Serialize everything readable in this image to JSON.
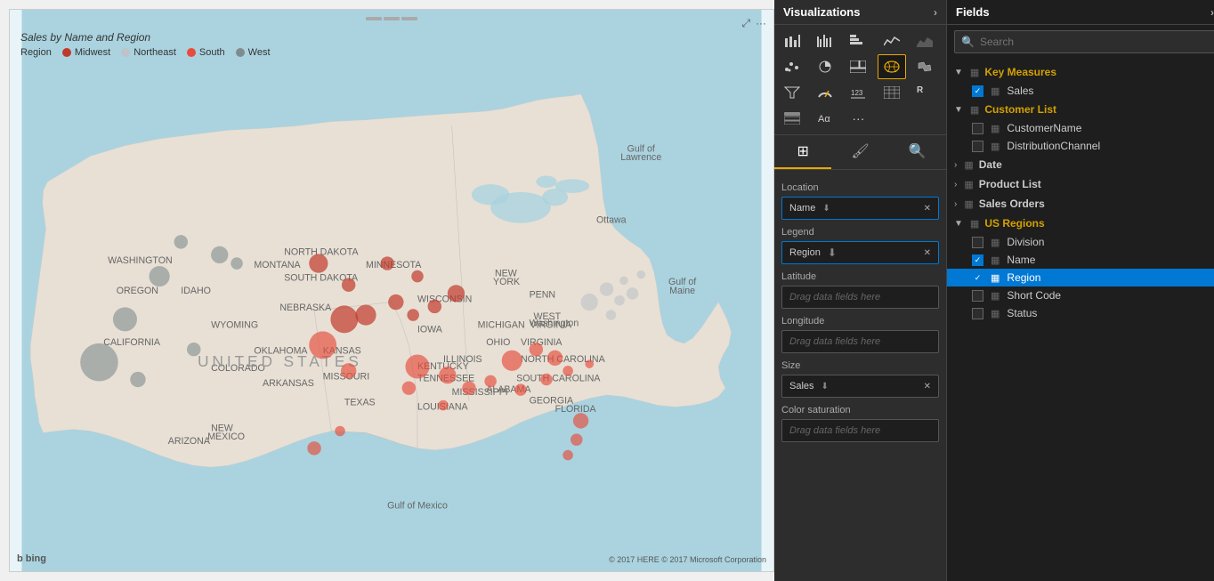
{
  "map": {
    "title": "Sales by Name and Region",
    "legend_label": "Region",
    "legend_items": [
      {
        "label": "Midwest",
        "color": "#c0392b"
      },
      {
        "label": "Northeast",
        "color": "#bdc3c7"
      },
      {
        "label": "South",
        "color": "#e74c3c"
      },
      {
        "label": "West",
        "color": "#7f8c8d"
      }
    ],
    "bing_label": "b bing",
    "copyright": "© 2017 HERE  © 2017 Microsoft Corporation"
  },
  "visualizations": {
    "header": "Visualizations",
    "tabs": [
      {
        "label": "⊞",
        "id": "fields"
      },
      {
        "label": "🖌",
        "id": "format"
      },
      {
        "label": "🔍",
        "id": "analytics"
      }
    ],
    "fields": {
      "location_label": "Location",
      "location_field": "Name",
      "legend_label": "Legend",
      "legend_field": "Region",
      "latitude_label": "Latitude",
      "latitude_placeholder": "Drag data fields here",
      "longitude_label": "Longitude",
      "longitude_placeholder": "Drag data fields here",
      "size_label": "Size",
      "size_field": "Sales",
      "color_label": "Color saturation",
      "color_placeholder": "Drag data fields here"
    }
  },
  "fields": {
    "header": "Fields",
    "expand_label": ">",
    "search_placeholder": "Search",
    "groups": [
      {
        "id": "key-measures",
        "label": "Key Measures",
        "color": "gold",
        "expanded": true,
        "icon": "table",
        "items": [
          {
            "label": "Sales",
            "checked": true
          }
        ]
      },
      {
        "id": "customer-list",
        "label": "Customer List",
        "color": "gold",
        "expanded": true,
        "icon": "table",
        "items": [
          {
            "label": "CustomerName",
            "checked": false
          },
          {
            "label": "DistributionChannel",
            "checked": false
          }
        ]
      },
      {
        "id": "date",
        "label": "Date",
        "color": "inherit",
        "expanded": false,
        "icon": "table",
        "items": []
      },
      {
        "id": "product-list",
        "label": "Product List",
        "color": "inherit",
        "expanded": false,
        "icon": "table",
        "items": []
      },
      {
        "id": "sales-orders",
        "label": "Sales Orders",
        "color": "inherit",
        "expanded": false,
        "icon": "table",
        "items": []
      },
      {
        "id": "us-regions",
        "label": "US Regions",
        "color": "gold",
        "expanded": true,
        "icon": "table",
        "items": [
          {
            "label": "Division",
            "checked": false
          },
          {
            "label": "Name",
            "checked": true
          },
          {
            "label": "Region",
            "checked": true,
            "selected": true
          },
          {
            "label": "Short Code",
            "checked": false
          },
          {
            "label": "Status",
            "checked": false
          }
        ]
      }
    ]
  }
}
